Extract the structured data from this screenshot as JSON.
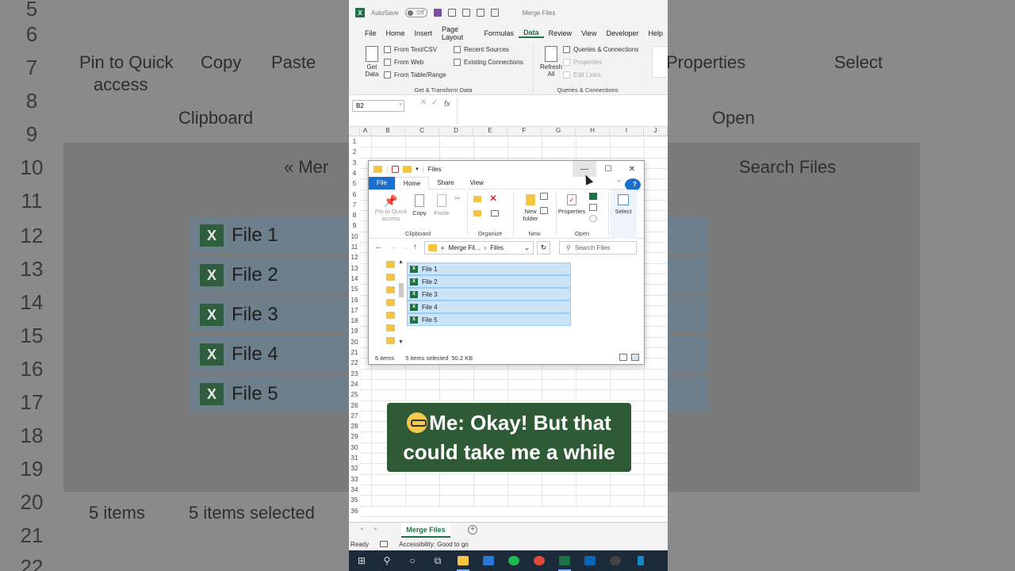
{
  "app": {
    "autosave_label": "AutoSave",
    "autosave_state": "Off",
    "doc_title": "Merge Files",
    "menu": [
      "File",
      "Home",
      "Insert",
      "Page Layout",
      "Formulas",
      "Data",
      "Review",
      "View",
      "Developer",
      "Help"
    ],
    "active_menu": "Data"
  },
  "ribbon": {
    "get_data": "Get Data",
    "from_text_csv": "From Text/CSV",
    "from_web": "From Web",
    "from_table_range": "From Table/Range",
    "recent_sources": "Recent Sources",
    "existing_connections": "Existing Connections",
    "group_get_transform": "Get & Transform Data",
    "refresh_all": "Refresh All",
    "queries_connections": "Queries & Connections",
    "properties": "Properties",
    "edit_links": "Edit Links",
    "group_queries": "Queries & Connections"
  },
  "formula": {
    "name_box": "B2",
    "fx": "fx"
  },
  "columns": [
    "A",
    "B",
    "C",
    "D",
    "E",
    "F",
    "G",
    "H",
    "I",
    "J"
  ],
  "rows": [
    "1",
    "2",
    "3",
    "4",
    "5",
    "6",
    "7",
    "8",
    "9",
    "10",
    "11",
    "12",
    "13",
    "14",
    "15",
    "16",
    "17",
    "18",
    "19",
    "20",
    "21",
    "22",
    "23",
    "24",
    "25",
    "26",
    "27",
    "28",
    "29",
    "30",
    "31",
    "32",
    "33",
    "34",
    "35",
    "36"
  ],
  "sheet": {
    "tab": "Merge Files",
    "add": "+",
    "status_ready": "Ready",
    "accessibility": "Accessibility: Good to go"
  },
  "explorer": {
    "title": "Files",
    "tabs": [
      "File",
      "Home",
      "Share",
      "View"
    ],
    "ribbon": {
      "pin": "Pin to Quick access",
      "copy": "Copy",
      "paste": "Paste",
      "clipboard": "Clipboard",
      "organize": "Organize",
      "new_folder": "New folder",
      "new": "New",
      "properties": "Properties",
      "open": "Open",
      "select": "Select"
    },
    "breadcrumb": [
      "Merge Fil...",
      "Files"
    ],
    "breadcrumb_prefix": "«",
    "search_placeholder": "Search Files",
    "files": [
      "File 1",
      "File 2",
      "File 3",
      "File 4",
      "File 5"
    ],
    "status_items": "5 items",
    "status_selected": "5 items selected",
    "status_size": "50.2 KB"
  },
  "caption": {
    "line1": "Me: Okay! But that",
    "line2": "could take me a while"
  },
  "background": {
    "rows": [
      "5",
      "6",
      "7",
      "8",
      "9",
      "10",
      "11",
      "12",
      "13",
      "14",
      "15",
      "16",
      "17",
      "18",
      "19",
      "20",
      "21",
      "22"
    ],
    "pin": "Pin to Quick",
    "pin2": "access",
    "copy": "Copy",
    "paste": "Paste",
    "clipboard": "Clipboard",
    "properties": "Properties",
    "open": "Open",
    "select": "Select",
    "search": "Search Files",
    "crumb": "« Mer",
    "files": [
      "File 1",
      "File 2",
      "File 3",
      "File 4",
      "File 5"
    ],
    "status_items": "5 items",
    "status_selected": "5 items selected"
  },
  "colors": {
    "excel_green": "#1e7145",
    "explorer_blue": "#1a6fd0",
    "selection": "#cce4f7",
    "caption_bg": "#2e5a36"
  }
}
